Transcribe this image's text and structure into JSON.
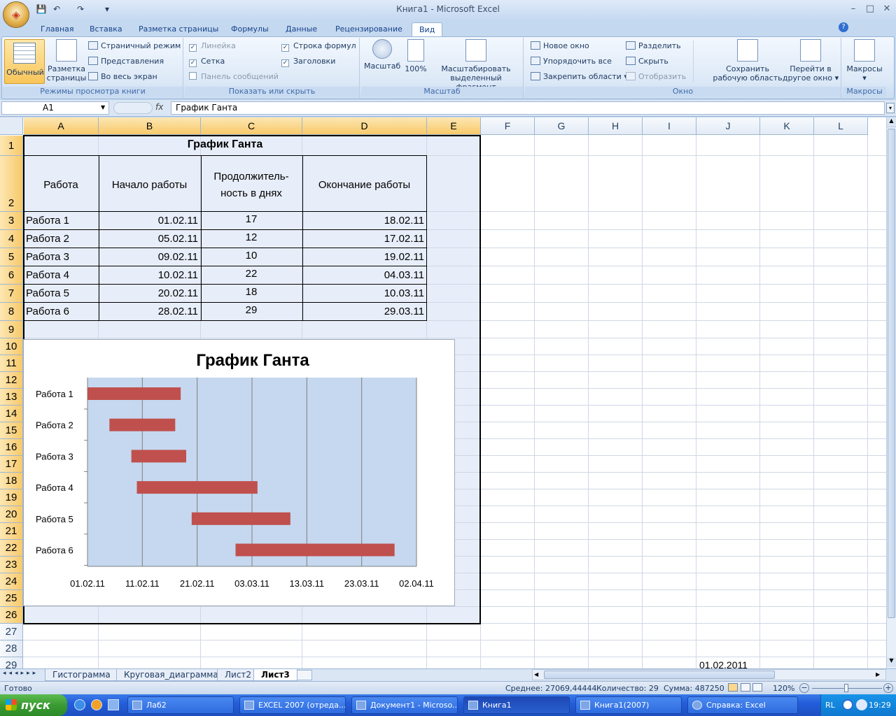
{
  "window": {
    "title": "Книга1 - Microsoft Excel",
    "minimize": "–",
    "maximize": "□",
    "close": "✕"
  },
  "qat": {
    "save": "💾",
    "undo": "↶",
    "redo": "↷",
    "more": "▾"
  },
  "tabs": [
    "Главная",
    "Вставка",
    "Разметка страницы",
    "Формулы",
    "Данные",
    "Рецензирование",
    "Вид"
  ],
  "active_tab": "Вид",
  "ribbon": {
    "views": {
      "label": "Режимы просмотра книги",
      "normal": "Обычный",
      "page_layout_1": "Разметка",
      "page_layout_2": "страницы",
      "page_mode": "Страничный режим",
      "custom_views": "Представления",
      "full_screen": "Во весь экран"
    },
    "show_hide": {
      "label": "Показать или скрыть",
      "ruler": "Линейка",
      "gridlines": "Сетка",
      "message_bar": "Панель сообщений",
      "formula_bar": "Строка формул",
      "headings": "Заголовки"
    },
    "zoom": {
      "label": "Масштаб",
      "zoom": "Масштаб",
      "hundred": "100%",
      "zoom_sel_1": "Масштабировать",
      "zoom_sel_2": "выделенный фрагмент"
    },
    "window": {
      "label": "Окно",
      "new_window": "Новое окно",
      "arrange_all": "Упорядочить все",
      "freeze": "Закрепить области",
      "split": "Разделить",
      "hide": "Скрыть",
      "unhide": "Отобразить",
      "save_ws_1": "Сохранить",
      "save_ws_2": "рабочую область",
      "switch_1": "Перейти в",
      "switch_2": "другое окно"
    },
    "macros": {
      "label": "Макросы",
      "macros": "Макросы"
    }
  },
  "formula_bar": {
    "name_box": "A1",
    "fx": "fx",
    "formula": "График Ганта"
  },
  "columns": [
    "A",
    "B",
    "C",
    "D",
    "E",
    "F",
    "G",
    "H",
    "I",
    "J",
    "K",
    "L"
  ],
  "rows": [
    "1",
    "2",
    "3",
    "4",
    "5",
    "6",
    "7",
    "8",
    "9",
    "10",
    "11",
    "12",
    "13",
    "14",
    "15",
    "16",
    "17",
    "18",
    "19",
    "20",
    "21",
    "22",
    "23",
    "24",
    "25",
    "26",
    "27",
    "28",
    "29"
  ],
  "table": {
    "title": "График Ганта",
    "headers": [
      "Работа",
      "Начало работы",
      "Продолжитель-",
      "ность в днях",
      "Окончание работы"
    ],
    "rows": [
      {
        "name": "Работа 1",
        "start": "01.02.11",
        "dur": "17",
        "end": "18.02.11"
      },
      {
        "name": "Работа 2",
        "start": "05.02.11",
        "dur": "12",
        "end": "17.02.11"
      },
      {
        "name": "Работа 3",
        "start": "09.02.11",
        "dur": "10",
        "end": "19.02.11"
      },
      {
        "name": "Работа 4",
        "start": "10.02.11",
        "dur": "22",
        "end": "04.03.11"
      },
      {
        "name": "Работа 5",
        "start": "20.02.11",
        "dur": "18",
        "end": "10.03.11"
      },
      {
        "name": "Работа 6",
        "start": "28.02.11",
        "dur": "29",
        "end": "29.03.11"
      }
    ]
  },
  "j29_value": "01.02.2011",
  "chart_data": {
    "type": "bar",
    "orientation": "horizontal",
    "title": "График Ганта",
    "categories": [
      "Работа 1",
      "Работа 2",
      "Работа 3",
      "Работа 4",
      "Работа 5",
      "Работа 6"
    ],
    "start": [
      "2011-02-01",
      "2011-02-05",
      "2011-02-09",
      "2011-02-10",
      "2011-02-20",
      "2011-02-28"
    ],
    "end": [
      "2011-02-18",
      "2011-02-17",
      "2011-02-19",
      "2011-03-04",
      "2011-03-10",
      "2011-03-29"
    ],
    "x_ticks": [
      "01.02.11",
      "11.02.11",
      "21.02.11",
      "03.03.11",
      "13.03.11",
      "23.03.11",
      "02.04.11"
    ],
    "xlim": [
      "2011-02-01",
      "2011-04-02"
    ],
    "bar_color": "#c0504d",
    "plot_bg": "#c5d8ef",
    "grid": true
  },
  "sheets": [
    "Гистограмма",
    "Круговая_диаграмма",
    "Лист2",
    "Лист3"
  ],
  "active_sheet": "Лист3",
  "status": {
    "ready": "Готово",
    "avg": "Среднее: 27069,44444",
    "count": "Количество: 29",
    "sum": "Сумма: 487250",
    "zoom": "120%"
  },
  "taskbar": {
    "start": "пуск",
    "items": [
      "Лаб2",
      "EXCEL 2007 (отреда...",
      "Документ1 - Microso...",
      "Книга1",
      "Книга1(2007)",
      "Справка: Excel"
    ],
    "active": "Книга1",
    "lang": "RL",
    "time": "19:29"
  }
}
